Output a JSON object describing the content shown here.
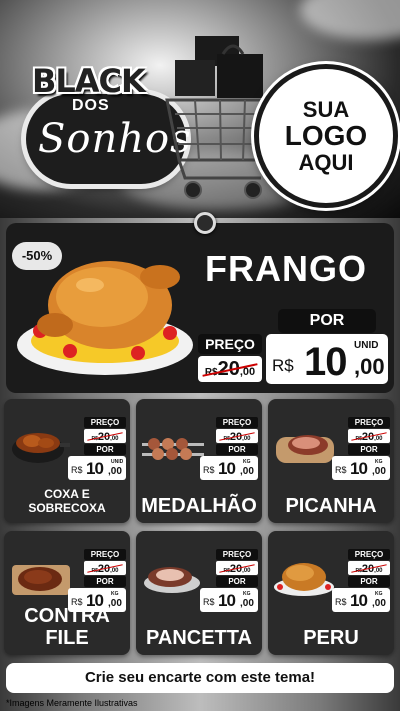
{
  "brand": {
    "line1": "BLACK",
    "line2": "DOS",
    "line3": "Sonhos"
  },
  "logo": {
    "line1": "SUA",
    "line2": "LOGO",
    "line3": "AQUI"
  },
  "featured": {
    "discount": "-50%",
    "name": "FRANGO",
    "preco_label": "PREÇO",
    "por_label": "POR",
    "old_price": {
      "currency": "R$",
      "int": "20",
      "dec": ",00"
    },
    "new_price": {
      "currency": "R$",
      "int": "10",
      "dec": ",00",
      "unit": "UNID"
    }
  },
  "products": [
    {
      "name": "COXA E SOBRECOXA",
      "preco_label": "PREÇO",
      "por_label": "POR",
      "old_currency": "R$",
      "old_int": "20",
      "old_dec": ",00",
      "currency": "R$",
      "int": "10",
      "dec": ",00",
      "unit": "UNID",
      "icon": "chicken-leg-pot-icon"
    },
    {
      "name": "MEDALHÃO",
      "preco_label": "PREÇO",
      "por_label": "POR",
      "old_currency": "R$",
      "old_int": "20",
      "old_dec": ",00",
      "currency": "R$",
      "int": "10",
      "dec": ",00",
      "unit": "KG",
      "icon": "meat-skewer-icon"
    },
    {
      "name": "PICANHA",
      "preco_label": "PREÇO",
      "por_label": "POR",
      "old_currency": "R$",
      "old_int": "20",
      "old_dec": ",00",
      "currency": "R$",
      "int": "10",
      "dec": ",00",
      "unit": "KG",
      "icon": "picanha-board-icon"
    },
    {
      "name": "CONTRA FILE",
      "preco_label": "PREÇO",
      "por_label": "POR",
      "old_currency": "R$",
      "old_int": "20",
      "old_dec": ",00",
      "currency": "R$",
      "int": "10",
      "dec": ",00",
      "unit": "KG",
      "icon": "steak-board-icon"
    },
    {
      "name": "PANCETTA",
      "preco_label": "PREÇO",
      "por_label": "POR",
      "old_currency": "R$",
      "old_int": "20",
      "old_dec": ",00",
      "currency": "R$",
      "int": "10",
      "dec": ",00",
      "unit": "KG",
      "icon": "pancetta-icon"
    },
    {
      "name": "PERU",
      "preco_label": "PREÇO",
      "por_label": "POR",
      "old_currency": "R$",
      "old_int": "20",
      "old_dec": ",00",
      "currency": "R$",
      "int": "10",
      "dec": ",00",
      "unit": "KG",
      "icon": "roast-turkey-icon"
    }
  ],
  "cta": "Crie seu encarte com este tema!",
  "disclaimer": "*Imagens Meramente Ilustrativas",
  "colors": {
    "dark": "#1b1b1b",
    "card": "#2a2a2a",
    "accent_red": "#cc0000",
    "white": "#ffffff"
  }
}
